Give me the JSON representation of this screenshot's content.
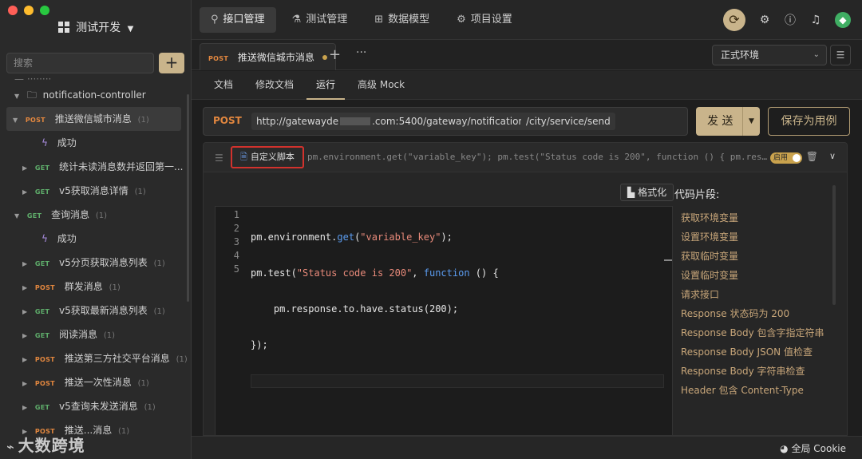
{
  "app": {
    "project_title": "测试开发",
    "watermark": "大数跨境"
  },
  "sidebar": {
    "search_placeholder": "搜索",
    "add_label": "+",
    "folder": "notification-controller",
    "items": [
      {
        "method": "POST",
        "label": "推送微信城市消息",
        "count": "(1)",
        "active": true
      },
      {
        "label": "成功"
      },
      {
        "method": "GET",
        "label": "统计未读消息数并返回第一..."
      },
      {
        "method": "GET",
        "label": "v5获取消息详情",
        "count": "(1)"
      },
      {
        "method": "GET",
        "label": "查询消息",
        "count": "(1)"
      },
      {
        "label": "成功"
      },
      {
        "method": "GET",
        "label": "v5分页获取消息列表",
        "count": "(1)"
      },
      {
        "method": "POST",
        "label": "群发消息",
        "count": "(1)"
      },
      {
        "method": "GET",
        "label": "v5获取最新消息列表",
        "count": "(1)"
      },
      {
        "method": "GET",
        "label": "阅读消息",
        "count": "(1)"
      },
      {
        "method": "POST",
        "label": "推送第三方社交平台消息",
        "count": "(1)"
      },
      {
        "method": "POST",
        "label": "推送一次性消息",
        "count": "(1)"
      },
      {
        "method": "GET",
        "label": "v5查询未发送消息",
        "count": "(1)"
      },
      {
        "method": "POST",
        "label": "推送...消息",
        "count": "(1)"
      }
    ]
  },
  "topnav": {
    "tabs": [
      {
        "label": "接口管理",
        "icon": "plug-icon",
        "active": true
      },
      {
        "label": "测试管理",
        "icon": "flask-icon"
      },
      {
        "label": "数据模型",
        "icon": "model-icon"
      },
      {
        "label": "项目设置",
        "icon": "gear-icon"
      }
    ]
  },
  "reqtab": {
    "method": "POST",
    "title": "推送微信城市消息",
    "new_tab": "+",
    "more": "···"
  },
  "env": {
    "selected": "正式环境"
  },
  "subtabs": [
    "文档",
    "修改文档",
    "运行",
    "高级 Mock"
  ],
  "request": {
    "method": "POST",
    "url_part1": "http://gatewayde",
    "url_part2": ".com:5400/gateway/notification",
    "url_part3": "/city/service/send",
    "send": "发 送",
    "save": "保存为用例"
  },
  "script": {
    "button": "自定义脚本",
    "preview": "pm.environment.get(\"variable_key\"); pm.test(\"Status code is 200\", function () { pm.response.to.have.status(2...",
    "toggle_label": "启用",
    "format_label": "格式化",
    "line_numbers": [
      "1",
      "2",
      "3",
      "4",
      "5"
    ]
  },
  "snippets": {
    "title": "代码片段:",
    "items": [
      "获取环境变量",
      "设置环境变量",
      "获取临时变量",
      "设置临时变量",
      "请求接口",
      "Response 状态码为 200",
      "Response Body 包含字指定符串",
      "Response Body JSON 值检查",
      "Response Body 字符串检查",
      "Header 包含 Content-Type"
    ]
  },
  "footer": {
    "cookie": "全局 Cookie"
  },
  "colors": {
    "accent": "#c9b48b",
    "post": "#e2873f",
    "get": "#5fae6b",
    "highlight_border": "#d2322d"
  }
}
